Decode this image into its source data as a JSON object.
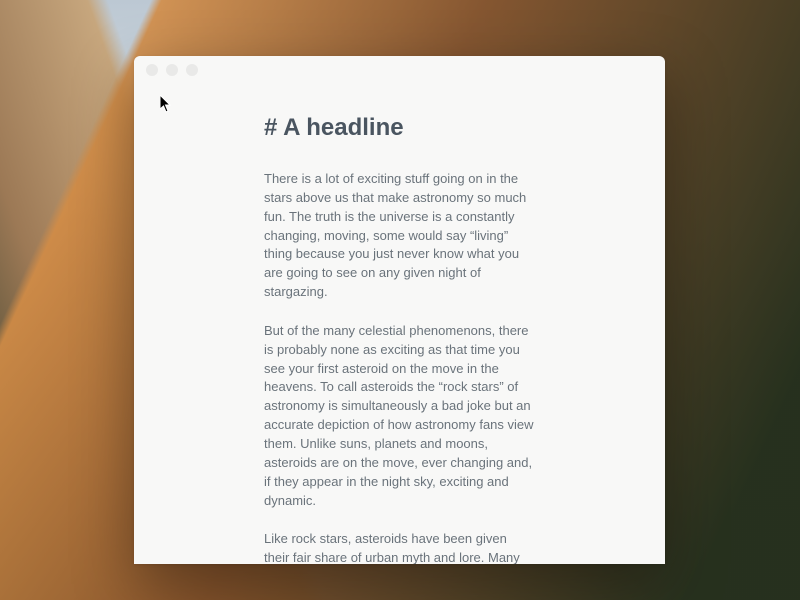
{
  "document": {
    "headline": "# A headline",
    "paragraphs": [
      "There is a lot of exciting stuff going on in the stars above us that make astronomy so much fun. The truth is the universe is a constantly changing, moving, some would say “living” thing because you just never know what you are going to see on any given night of stargazing.",
      "But of the many celestial phenomenons, there is probably none as exciting as that time you see your first asteroid on the move in the heavens. To call asteroids the “rock stars” of astronomy is simultaneously a bad joke but an accurate depiction of how astronomy fans view them. Unlike suns, planets and moons, asteroids are on the move, ever changing and, if they appear in the night sky, exciting and dynamic.",
      "Like rock stars, asteroids have been given their fair share of urban myth and lore. Many have"
    ]
  }
}
